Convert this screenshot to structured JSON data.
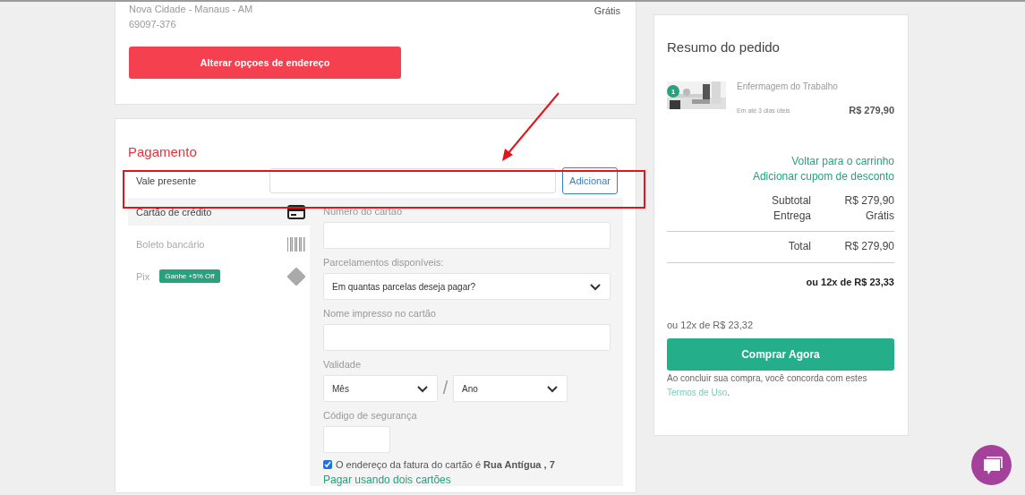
{
  "address": {
    "lines": [
      "Nova Cidade - Manaus - AM",
      "69097-376"
    ],
    "shipping_price": "Grátis",
    "change_button": "Alterar opçoes de endereço"
  },
  "payment": {
    "title": "Pagamento",
    "gift_card": {
      "label": "Vale presente",
      "button": "Adicionar"
    },
    "methods": [
      {
        "kind": "card",
        "label": "Cartão de crédito",
        "selected": true
      },
      {
        "kind": "boleto",
        "label": "Boleto bancário",
        "selected": false
      },
      {
        "kind": "pix",
        "label": "Pix",
        "selected": false,
        "badge": "Ganhe +5% Off"
      }
    ],
    "fields": [
      {
        "kind": "input",
        "label": "Número do cartão"
      },
      {
        "kind": "select",
        "label": "Parcelamentos disponíveis:",
        "value": "Em quantas parcelas deseja pagar?"
      },
      {
        "kind": "input",
        "label": "Nome impresso no cartão"
      },
      {
        "kind": "expiry",
        "label": "Validade",
        "month": "Mês",
        "separator": "/",
        "year": "Ano"
      },
      {
        "kind": "short",
        "label": "Código de segurança"
      }
    ],
    "billing": {
      "checked": true,
      "text": "O endereço da fatura do cartão é **Rua Antígua , 7**"
    },
    "two_cards_link": "Pagar usando dois cartões"
  },
  "summary": {
    "title": "Resumo do pedido",
    "product": {
      "quantity": "1",
      "name": "Enfermagem do Trabalho",
      "delivery": "Em até 3 dias úteis",
      "price": "R$ 279,90"
    },
    "links": [
      "Voltar para o carrinho",
      "Adicionar cupom de desconto"
    ],
    "totals": [
      {
        "label": "Subtotal",
        "value": "R$ 279,90"
      },
      {
        "label": "Entrega",
        "value": "Grátis"
      }
    ],
    "total": {
      "label": "Total",
      "value": "R$ 279,90"
    },
    "installments_bold": "ou 12x de R$ 23,33",
    "installments": "ou 12x de R$ 23,32",
    "buy_button": "Comprar Agora",
    "terms_text": "Ao concluir sua compra, você concorda com estes",
    "terms_link": "Termos de Uso",
    "terms_end": "."
  }
}
